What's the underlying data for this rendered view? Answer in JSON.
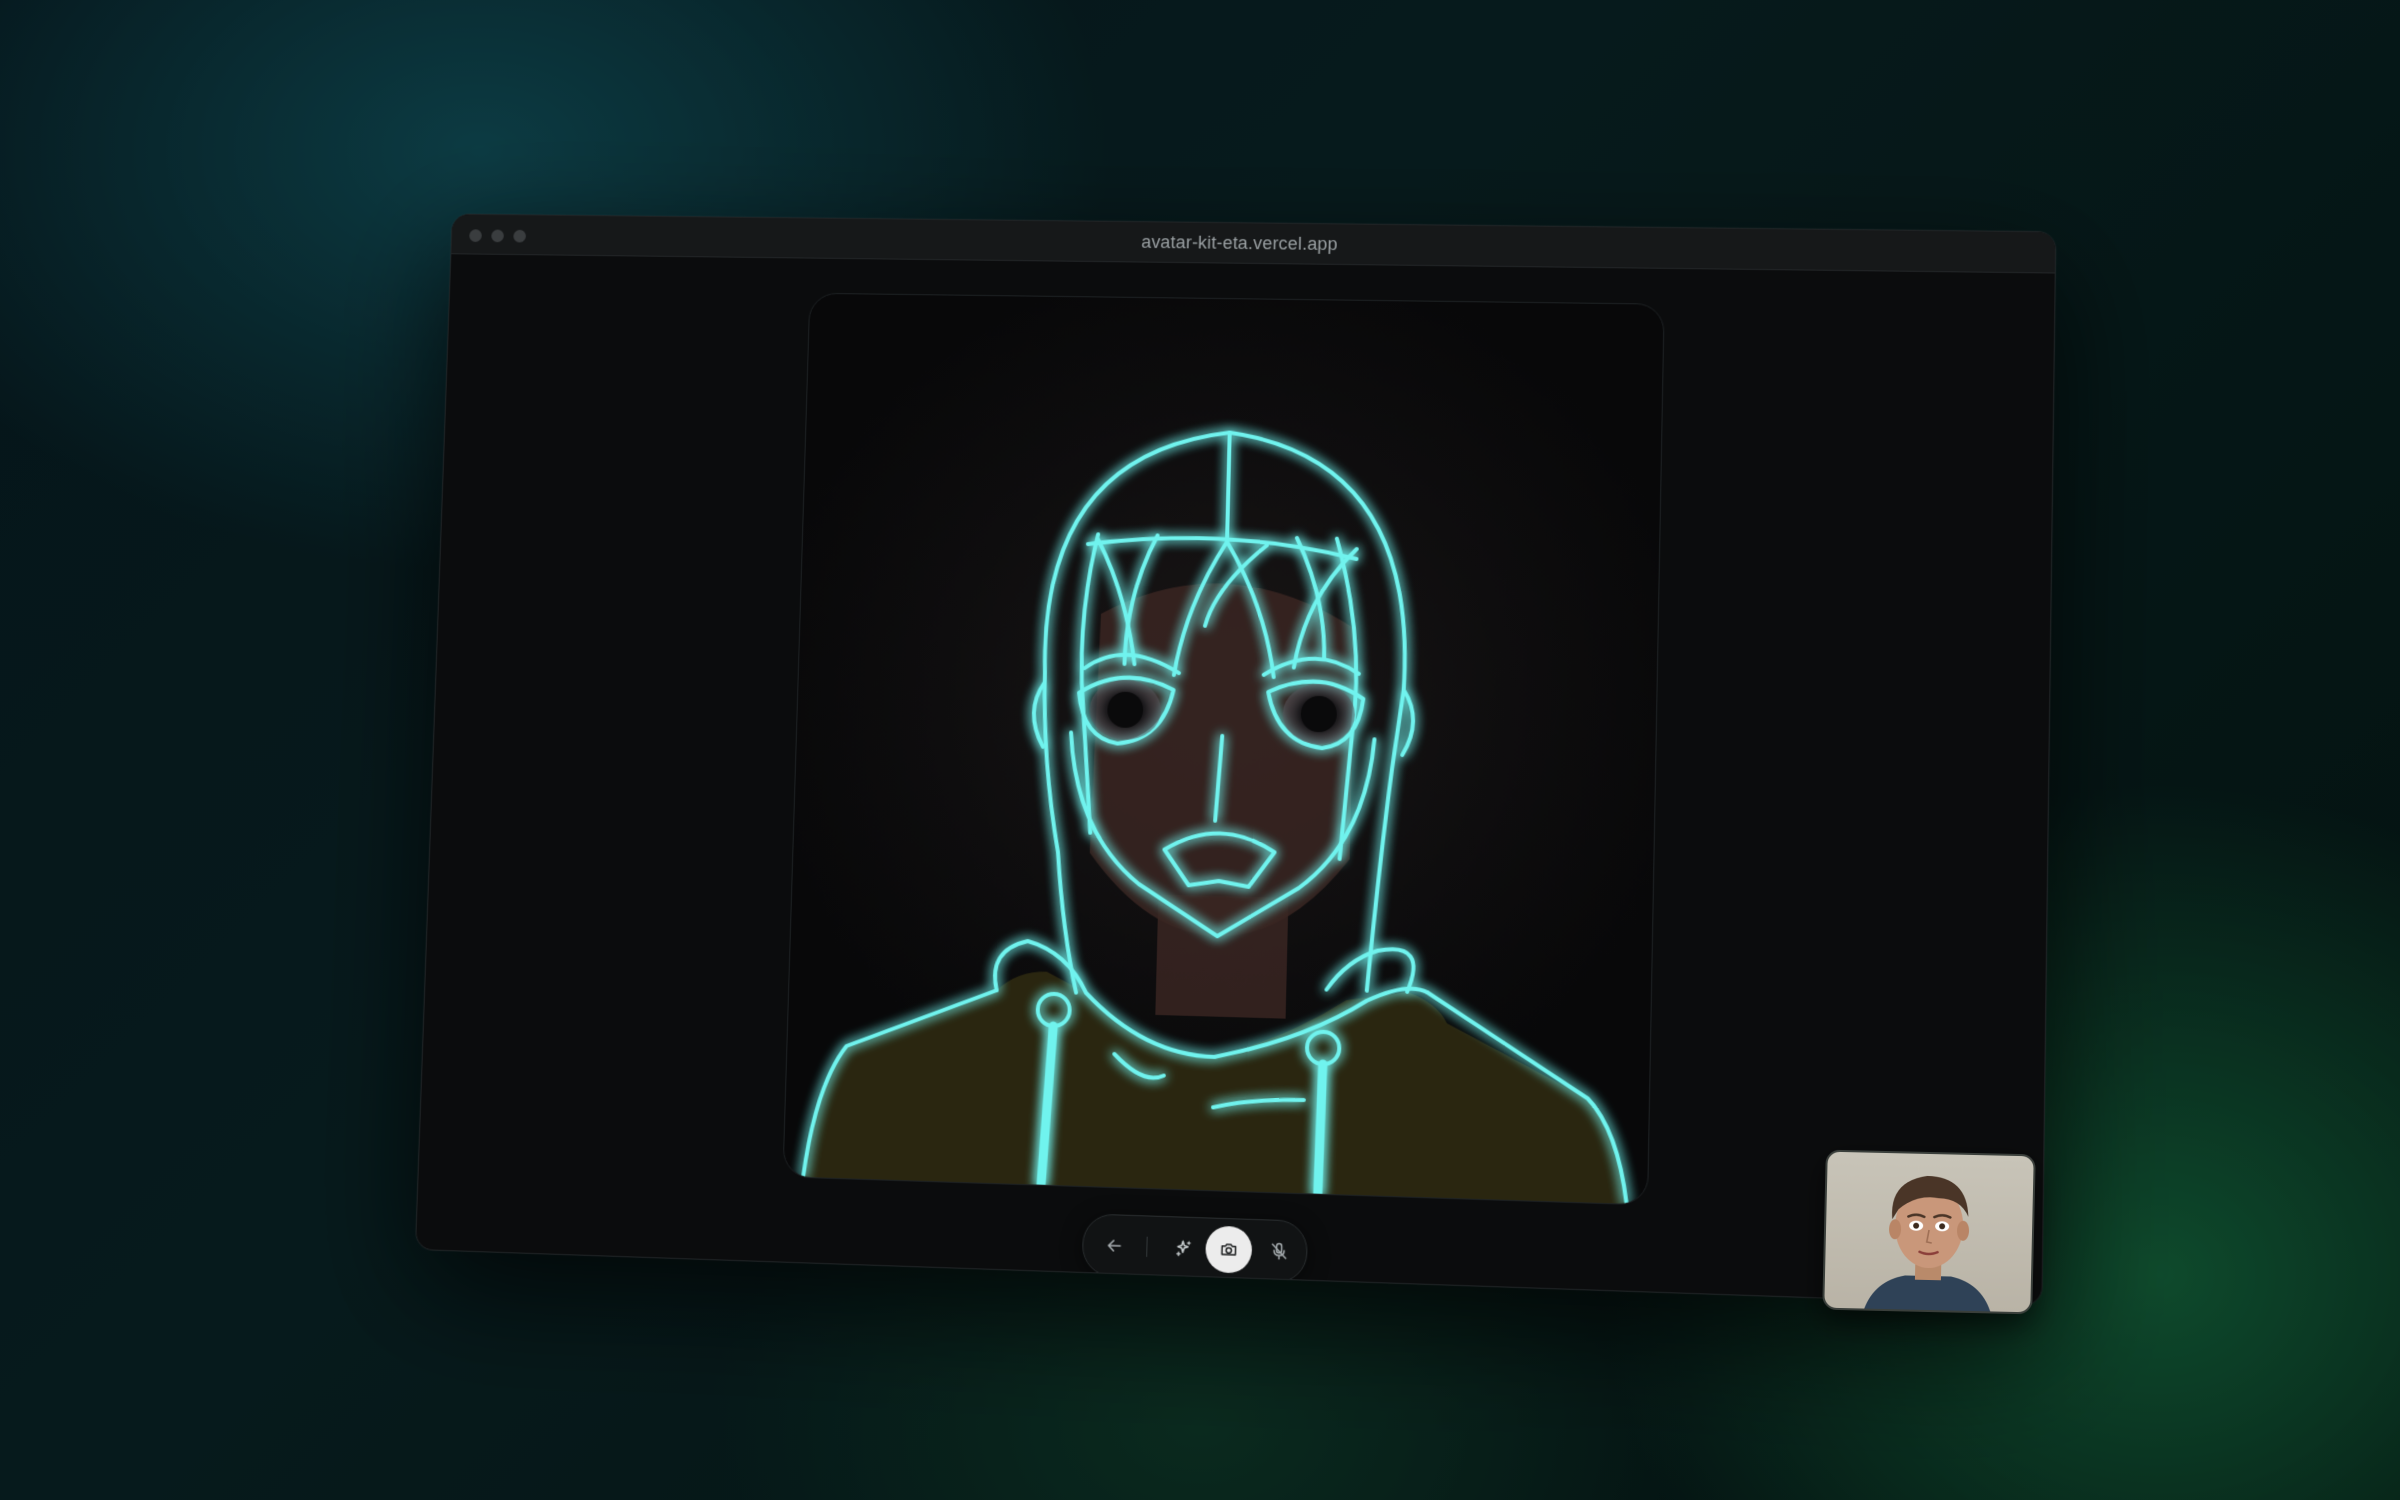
{
  "browser": {
    "url": "avatar-kit-eta.vercel.app"
  },
  "avatar": {
    "line_color": "#6ff3ee",
    "skin_color": "#3a2622",
    "hoodie_color": "#2a2610"
  },
  "controls": {
    "back_icon": "arrow-left-icon",
    "effects_icon": "sparkles-icon",
    "camera_icon": "camera-icon",
    "mic_icon": "mic-off-icon"
  },
  "self_view": {
    "background_color": "#c2bdb1"
  }
}
